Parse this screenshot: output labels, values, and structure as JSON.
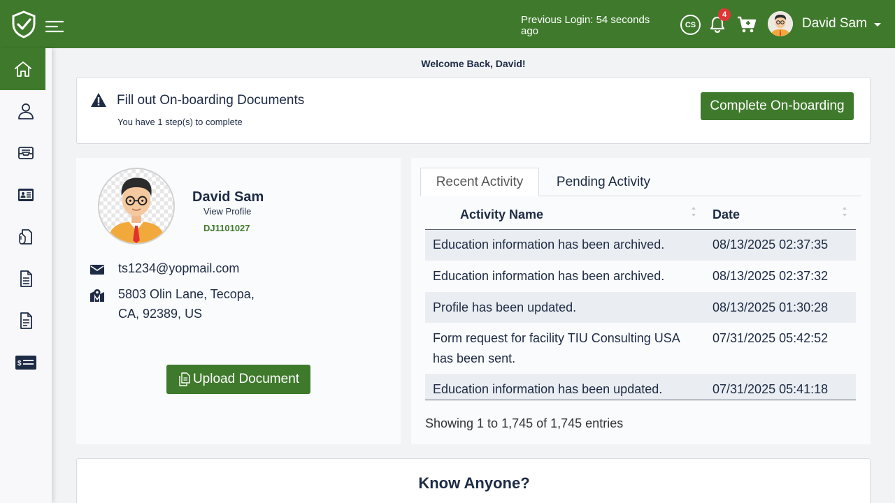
{
  "header": {
    "previous_login": "Previous Login: 54 seconds ago",
    "cs_label": "CS",
    "notification_count": "4",
    "user_name": "David Sam"
  },
  "sidebar": {
    "items": [
      {
        "icon": "home-icon",
        "active": true
      },
      {
        "icon": "user-icon",
        "active": false
      },
      {
        "icon": "inbox-icon",
        "active": false
      },
      {
        "icon": "id-card-icon",
        "active": false
      },
      {
        "icon": "document-hand-icon",
        "active": false
      },
      {
        "icon": "file-text-icon",
        "active": false
      },
      {
        "icon": "file-lines-icon",
        "active": false
      },
      {
        "icon": "payment-card-icon",
        "active": false
      }
    ]
  },
  "welcome": "Welcome Back, David!",
  "onboarding": {
    "title": "Fill out On-boarding Documents",
    "subtitle": "You have 1 step(s) to complete",
    "button": "Complete On-boarding"
  },
  "profile": {
    "name": "David Sam",
    "view_profile": "View Profile",
    "id": "DJ1101027",
    "email": "ts1234@yopmail.com",
    "address_line1": "5803 Olin Lane, Tecopa,",
    "address_line2": "CA, 92389, US",
    "upload_button": "Upload Document"
  },
  "activity": {
    "tabs": [
      "Recent Activity",
      "Pending Activity"
    ],
    "columns": [
      "Activity Name",
      "Date"
    ],
    "rows": [
      {
        "name": "Education information has been archived.",
        "name2": "",
        "date": "08/13/2025 02:37:35"
      },
      {
        "name": "Education information has been archived.",
        "name2": "",
        "date": "08/13/2025 02:37:32"
      },
      {
        "name": "Profile has been updated.",
        "name2": "",
        "date": "08/13/2025 01:30:28"
      },
      {
        "name": "Form request for facility TIU Consulting USA",
        "name2": "has been sent.",
        "date": "07/31/2025 05:42:52"
      },
      {
        "name": "Education information has been updated.",
        "name2": "",
        "date": "07/31/2025 05:41:18"
      }
    ],
    "entries_text": "Showing 1 to 1,745 of 1,745 entries"
  },
  "know_anyone": "Know Anyone?"
}
